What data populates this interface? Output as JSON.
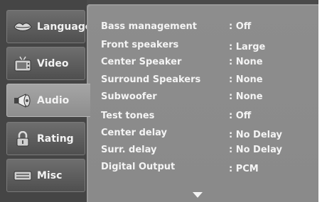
{
  "sidebar": {
    "tabs": [
      {
        "label": "Language",
        "icon": "lips-icon"
      },
      {
        "label": "Video",
        "icon": "tv-icon"
      },
      {
        "label": "Audio",
        "icon": "speaker-icon"
      },
      {
        "label": "Rating",
        "icon": "padlock-icon"
      },
      {
        "label": "Misc",
        "icon": "misc-icon"
      }
    ],
    "active": "Audio"
  },
  "settings": [
    {
      "name": "Bass management",
      "value": ": Off"
    },
    {
      "name": "Front  speakers",
      "value": ": Large"
    },
    {
      "name": "Center Speaker",
      "value": ": None"
    },
    {
      "name": "Surround Speakers",
      "value": ": None"
    },
    {
      "name": "Subwoofer",
      "value": ": None"
    },
    {
      "name": "Test tones",
      "value": ": Off"
    },
    {
      "name": "Center delay",
      "value": ": No Delay"
    },
    {
      "name": "Surr. delay",
      "value": ": No Delay"
    },
    {
      "name": "Digital Output",
      "value": ": PCM"
    }
  ],
  "colors": {
    "background": "#4a4a4a",
    "panel": "#8c8c8c",
    "text": "#f4f4f4"
  }
}
